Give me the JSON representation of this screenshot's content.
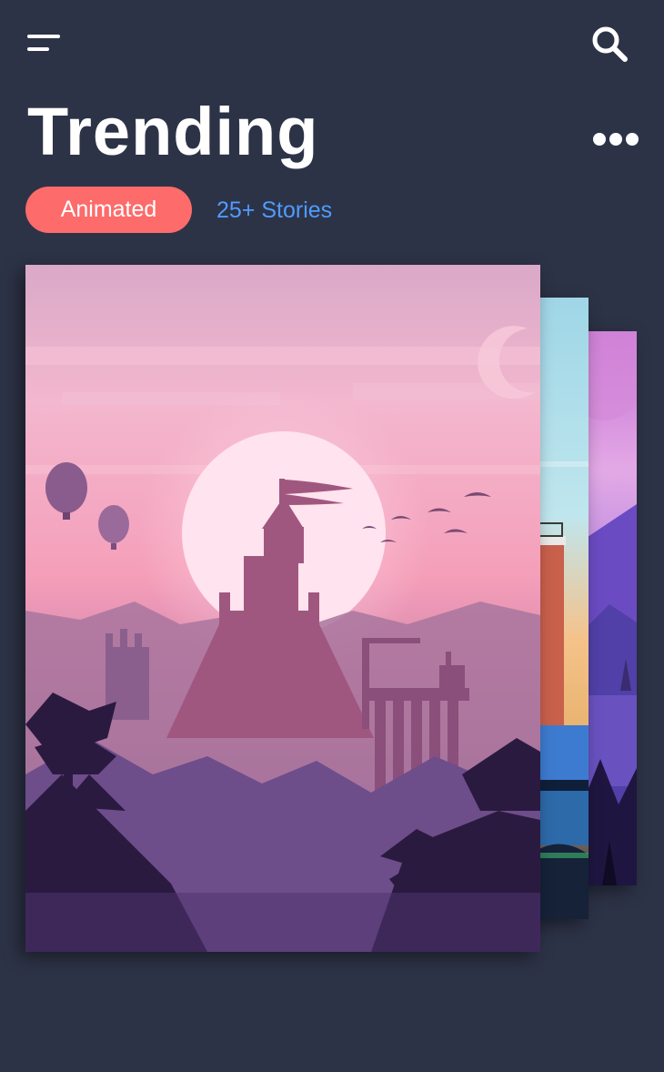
{
  "header": {
    "menu_icon": "menu-icon",
    "search_icon": "search-icon",
    "title": "Trending",
    "more_icon": "more-horizontal-icon"
  },
  "filter": {
    "category_label": "Animated",
    "category_color": "#fd6b6b",
    "stories_label": "25+ Stories",
    "stories_color": "#4f9bff"
  },
  "theme": {
    "background": "#2d3347"
  },
  "cards": [
    {
      "id": "castle-sunset",
      "description": "Pink sunset castle illustration with hot air balloons and birds"
    },
    {
      "id": "lighthouse",
      "description": "Blue sky lighthouse illustration"
    },
    {
      "id": "purple-mountains",
      "description": "Purple mountain landscape illustration"
    }
  ]
}
